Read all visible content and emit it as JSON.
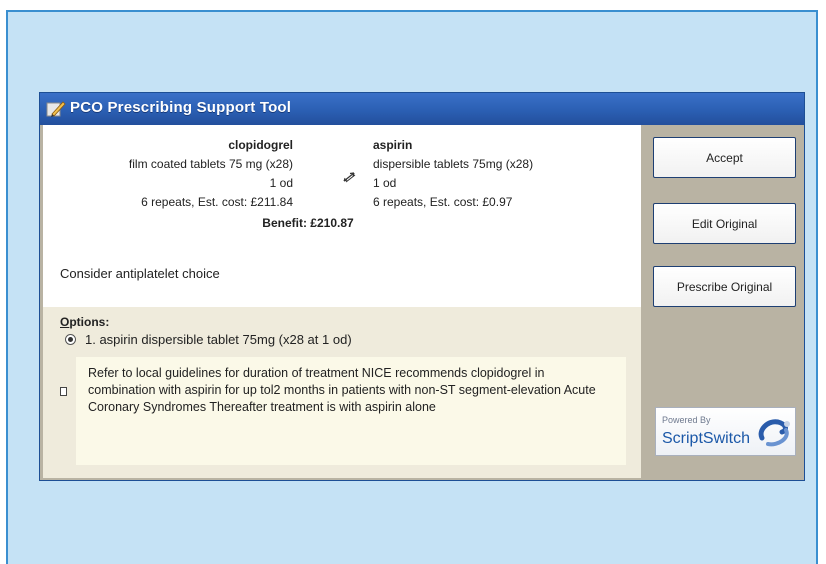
{
  "window": {
    "title": "PCO Prescribing Support Tool",
    "icon": "tool-icon"
  },
  "recommendation": {
    "original": {
      "name": "clopidogrel",
      "form": "film coated tablets 75 mg (x28)",
      "dose": "1 od",
      "repeats_cost": "6 repeats, Est. cost: £211.84"
    },
    "suggested": {
      "name": "aspirin",
      "form": "dispersible tablets 75mg (x28)",
      "dose": "1 od",
      "repeats_cost": "6 repeats, Est. cost: £0.97"
    },
    "switch_icon": "switch-arrows-icon",
    "benefit": "Benefit: £210.87",
    "message": "Consider antiplatelet choice"
  },
  "options": {
    "title_prefix": "O",
    "title_rest": "ptions:",
    "items": [
      {
        "label": "1. aspirin dispersible tablet 75mg (x28 at 1 od)",
        "selected": true
      }
    ],
    "note": "Refer to local guidelines for duration of treatment  NICE recommends clopidogrel in combination with aspirin for up tol2 months in patients with non-ST segment-elevation Acute Coronary Syndromes  Thereafter treatment is with aspirin alone"
  },
  "buttons": {
    "accept": "Accept",
    "edit_original": "Edit Original",
    "prescribe_original": "Prescribe Original"
  },
  "logo": {
    "powered_by": "Powered By",
    "brand": "ScriptSwitch"
  },
  "colors": {
    "background_panel": "#c5e2f5",
    "titlebar": "#2b5fb3",
    "sidebar": "#b9b3a3",
    "options_bg": "#efebdc",
    "note_bg": "#fbf9e8"
  }
}
